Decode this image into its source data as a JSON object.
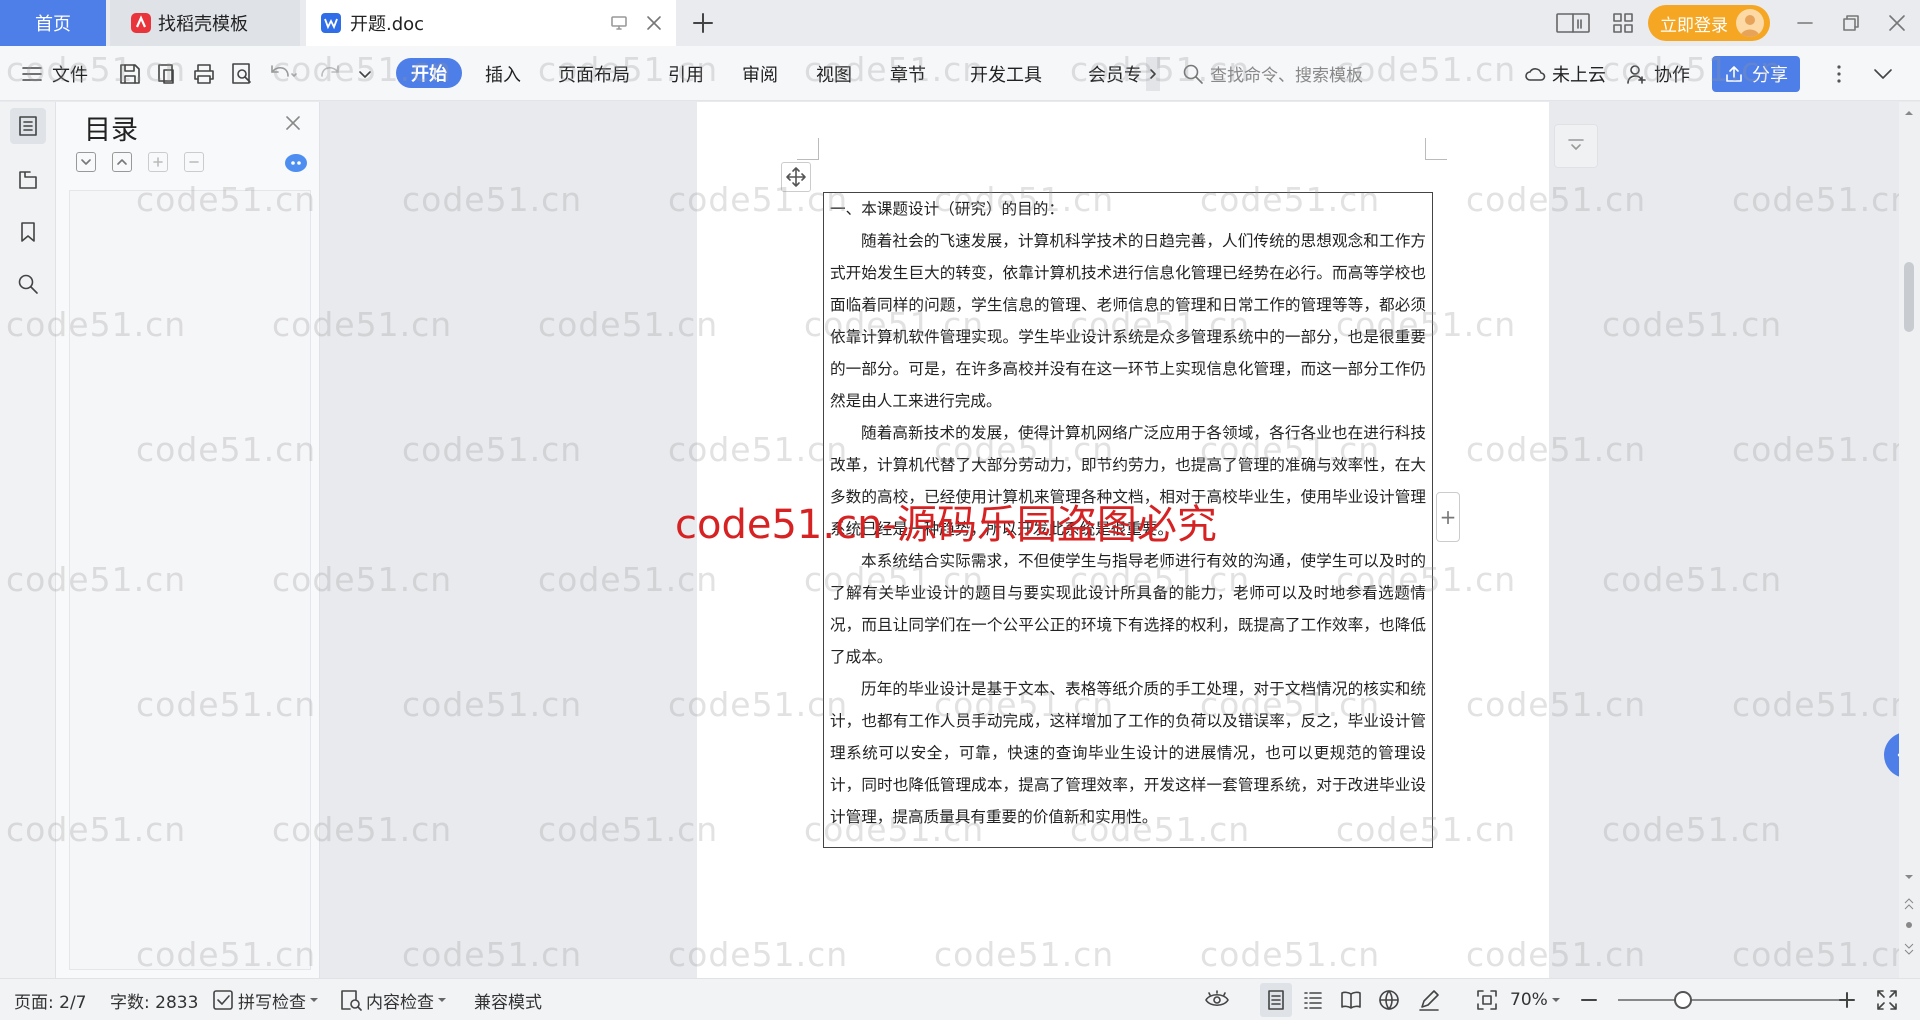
{
  "tabs": {
    "home": "首页",
    "template": "找稻壳模板",
    "document": "开题.doc"
  },
  "titlebar": {
    "login_label": "立即登录"
  },
  "toolbar": {
    "file_menu": "文件",
    "ribbon_tabs": [
      "开始",
      "插入",
      "页面布局",
      "引用",
      "审阅",
      "视图",
      "章节",
      "开发工具",
      "会员专"
    ],
    "search_placeholder": "查找命令、搜索模板",
    "cloud_label": "未上云",
    "collab_label": "协作",
    "share_label": "分享"
  },
  "toc": {
    "title": "目录"
  },
  "document": {
    "heading": "一、本课题设计（研究）的目的：",
    "paragraphs": [
      "随着社会的飞速发展，计算机科学技术的日趋完善，人们传统的思想观念和工作方式开始发生巨大的转变，依靠计算机技术进行信息化管理已经势在必行。而高等学校也面临着同样的问题，学生信息的管理、老师信息的管理和日常工作的管理等等，都必须依靠计算机软件管理实现。学生毕业设计系统是众多管理系统中的一部分，也是很重要的一部分。可是，在许多高校并没有在这一环节上实现信息化管理，而这一部分工作仍然是由人工来进行完成。",
      "随着高新技术的发展，使得计算机网络广泛应用于各领域，各行各业也在进行科技改革，计算机代替了大部分劳动力，即节约劳力，也提高了管理的准确与效率性，在大多数的高校，已经使用计算机来管理各种文档，相对于高校毕业生，使用毕业设计管理系统已经是一种趋势，所以开发此系统是很重要。",
      "本系统结合实际需求，不但使学生与指导老师进行有效的沟通，使学生可以及时的了解有关毕业设计的题目与要实现此设计所具备的能力，老师可以及时地参看选题情况，而且让同学们在一个公平公正的环境下有选择的权利，既提高了工作效率，也降低了成本。",
      "历年的毕业设计是基于文本、表格等纸介质的手工处理，对于文档情况的核实和统计，也都有工作人员手动完成，这样增加了工作的负荷以及错误率，反之，毕业设计管理系统可以安全，可靠，快速的查询毕业生设计的进展情况，也可以更规范的管理设计，同时也降低管理成本，提高了管理效率，开发这样一套管理系统，对于改进毕业设计管理，提高质量具有重要的价值新和实用性。"
    ]
  },
  "watermark": {
    "text": "code51.cn",
    "main": "code51.cn-源码乐园盗图必究"
  },
  "statusbar": {
    "page": "页面: 2/7",
    "word_count": "字数: 2833",
    "spell_check": "拼写检查",
    "content_check": "内容检查",
    "compat_mode": "兼容模式",
    "zoom": "70%"
  },
  "colors": {
    "accent": "#4e7ee8",
    "login": "#f5a623",
    "watermark_main": "#d62222"
  }
}
